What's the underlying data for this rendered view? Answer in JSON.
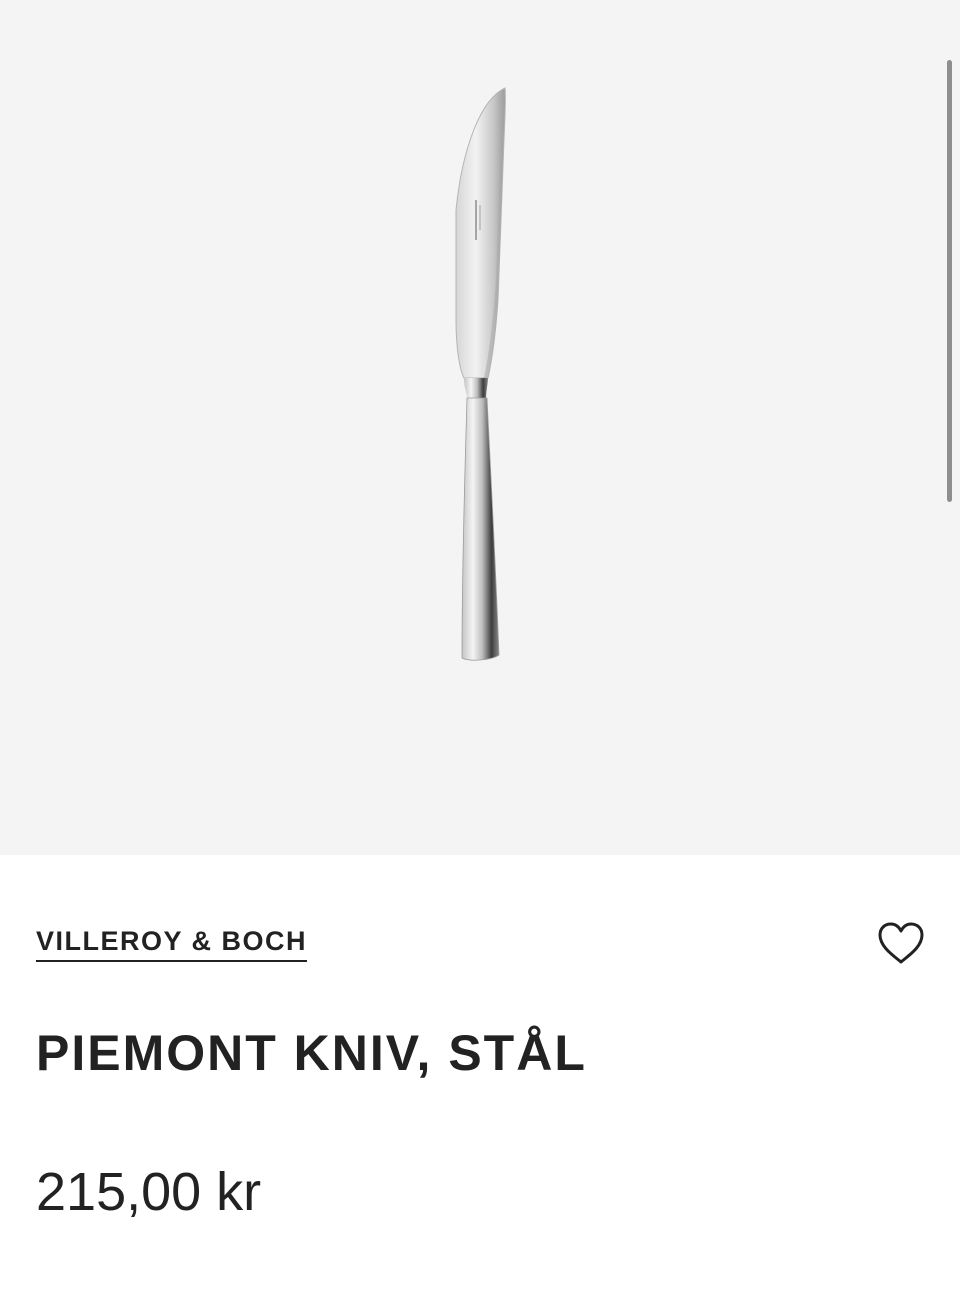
{
  "product": {
    "brand": "VILLEROY & BOCH",
    "title": "PIEMONT KNIV, STÅL",
    "price": "215,00 kr",
    "image_icon": "knife-image",
    "wishlist_icon": "heart-icon"
  },
  "colors": {
    "image_background": "#f4f4f4",
    "text": "#222222",
    "scrollbar": "#8e8e8e"
  }
}
